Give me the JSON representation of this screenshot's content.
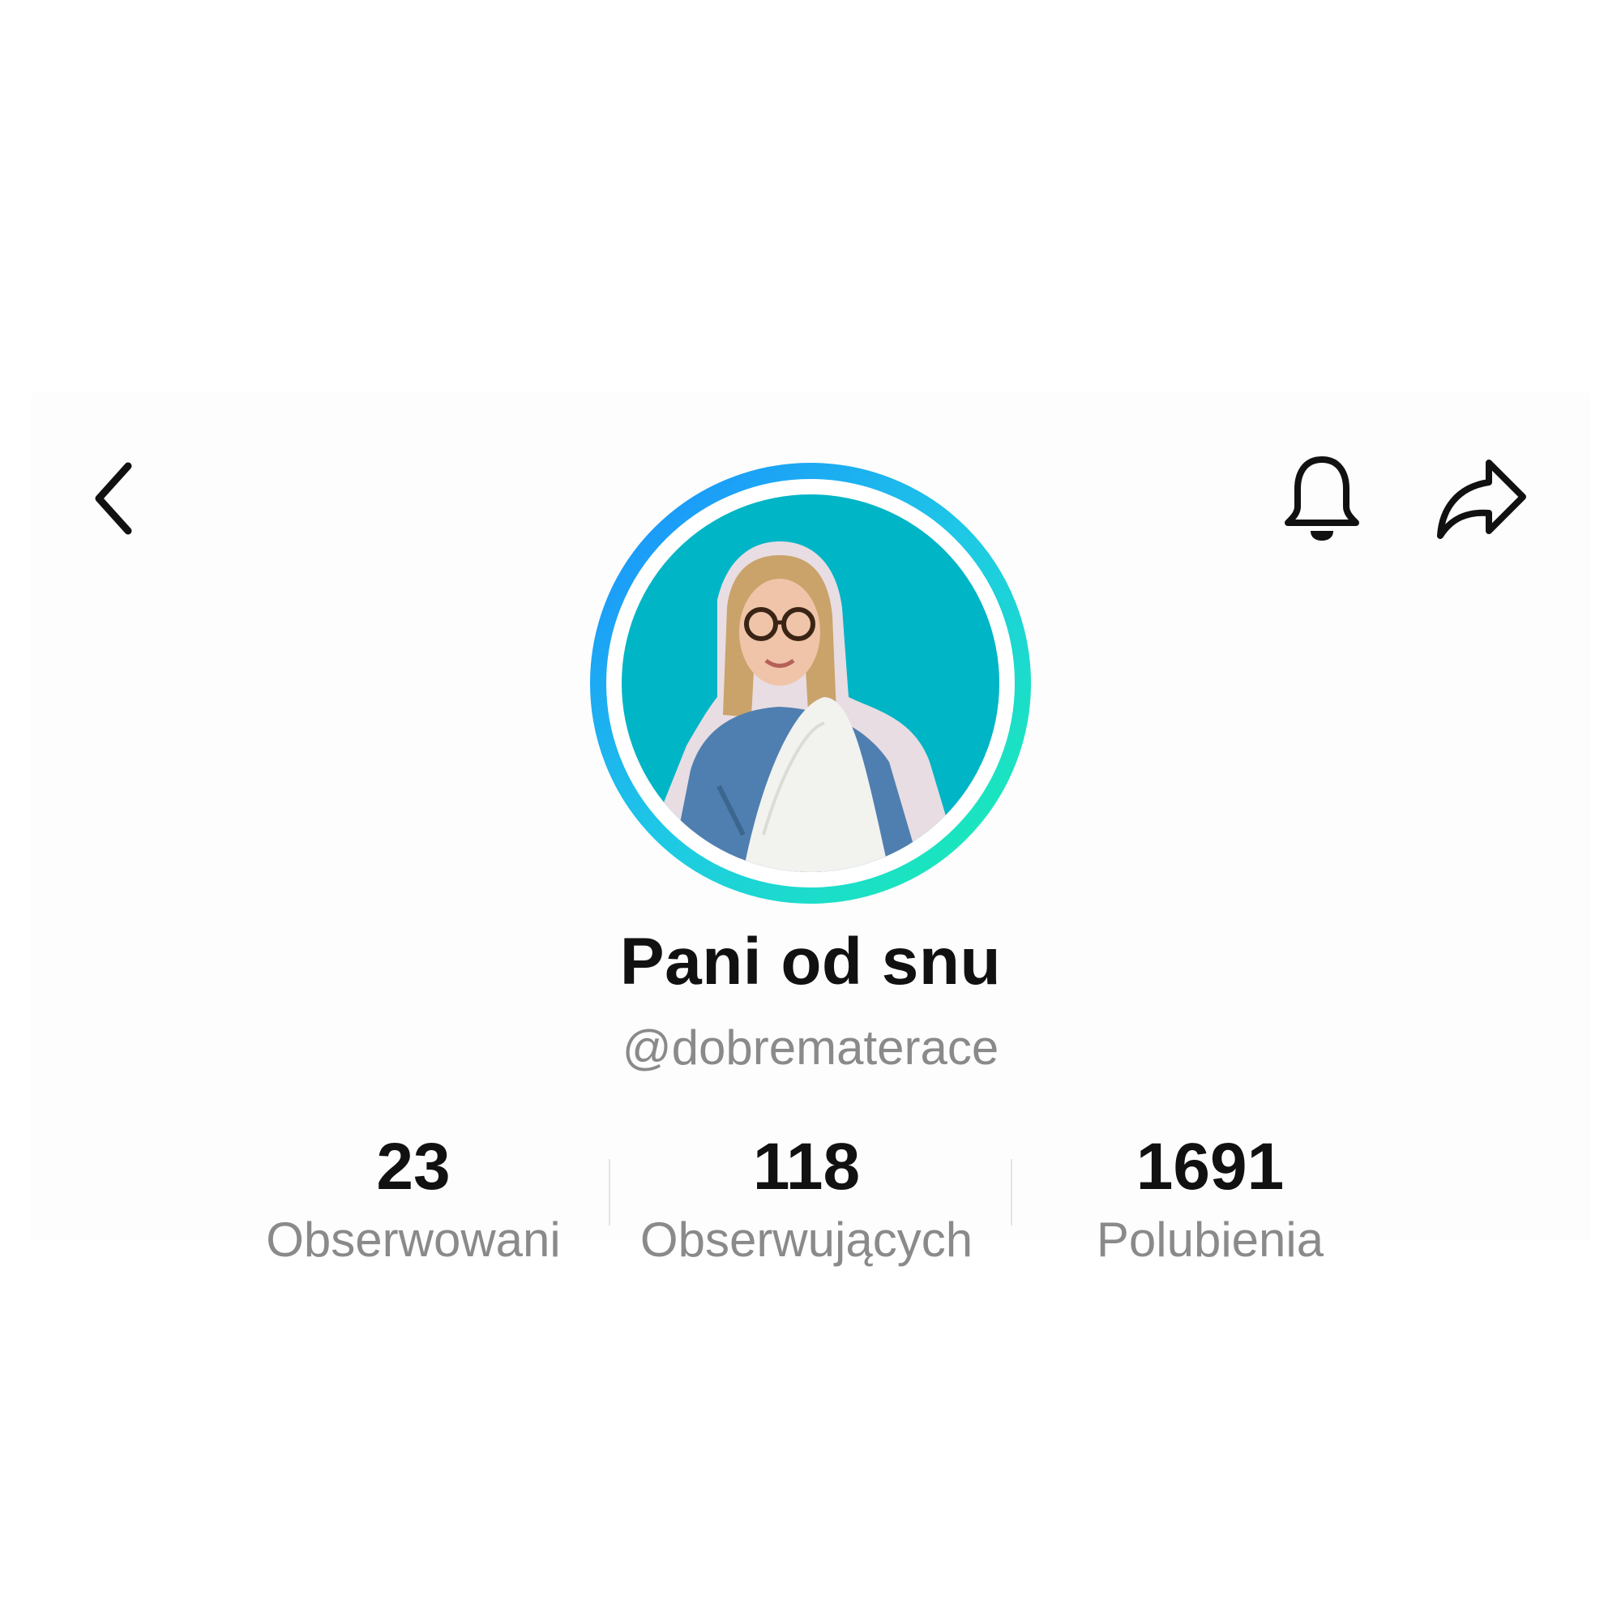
{
  "profile": {
    "display_name": "Pani od snu",
    "username": "@dobrematerace"
  },
  "header": {
    "back_icon": "chevron-left-icon",
    "notification_icon": "bell-icon",
    "share_icon": "share-arrow-icon"
  },
  "avatar": {
    "ring_colors": [
      "#1a8cff",
      "#1ec8e6",
      "#19f0b0"
    ],
    "background_color": "#00b5c6"
  },
  "stats": [
    {
      "value": "23",
      "label": "Obserwowani"
    },
    {
      "value": "118",
      "label": "Obserwujących"
    },
    {
      "value": "1691",
      "label": "Polubienia"
    }
  ]
}
